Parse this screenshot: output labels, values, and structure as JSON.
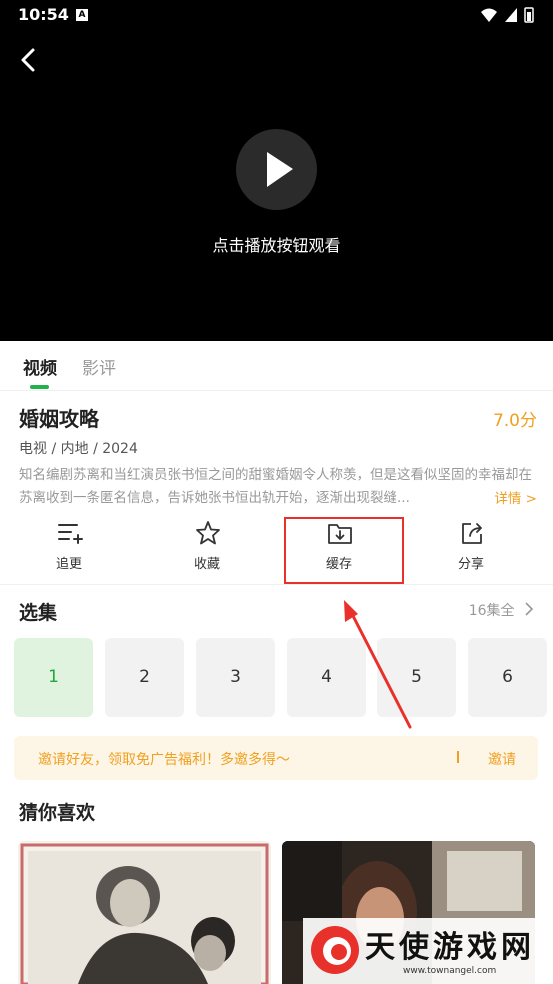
{
  "status_bar": {
    "time": "10:54",
    "a_badge": "A"
  },
  "player": {
    "hint": "点击播放按钮观看"
  },
  "tabs": [
    "视频",
    "影评"
  ],
  "info": {
    "title": "婚姻攻略",
    "score": "7.0分",
    "meta": "电视 / 内地 / 2024",
    "description": "知名编剧苏离和当红演员张书恒之间的甜蜜婚姻令人称羡，但是这看似坚固的幸福却在苏离收到一条匿名信息，告诉她张书恒出轨开始，逐渐出现裂缝...",
    "more": "详情 >"
  },
  "actions": [
    {
      "label": "追更",
      "icon": "add-list-icon"
    },
    {
      "label": "收藏",
      "icon": "star-icon"
    },
    {
      "label": "缓存",
      "icon": "download-folder-icon"
    },
    {
      "label": "分享",
      "icon": "share-icon"
    }
  ],
  "episodes": {
    "title": "选集",
    "all": "16集全",
    "items": [
      "1",
      "2",
      "3",
      "4",
      "5",
      "6"
    ],
    "selected": "1"
  },
  "invite": {
    "text": "邀请好友，领取免广告福利！多邀多得～",
    "button": "邀请"
  },
  "recommend": {
    "title": "猜你喜欢"
  },
  "watermark": {
    "name": "天使游戏网",
    "url": "www.townangel.com"
  },
  "colors": {
    "accent_green": "#22b14c",
    "accent_orange": "#f0a020",
    "highlight_red": "#e8312a"
  }
}
